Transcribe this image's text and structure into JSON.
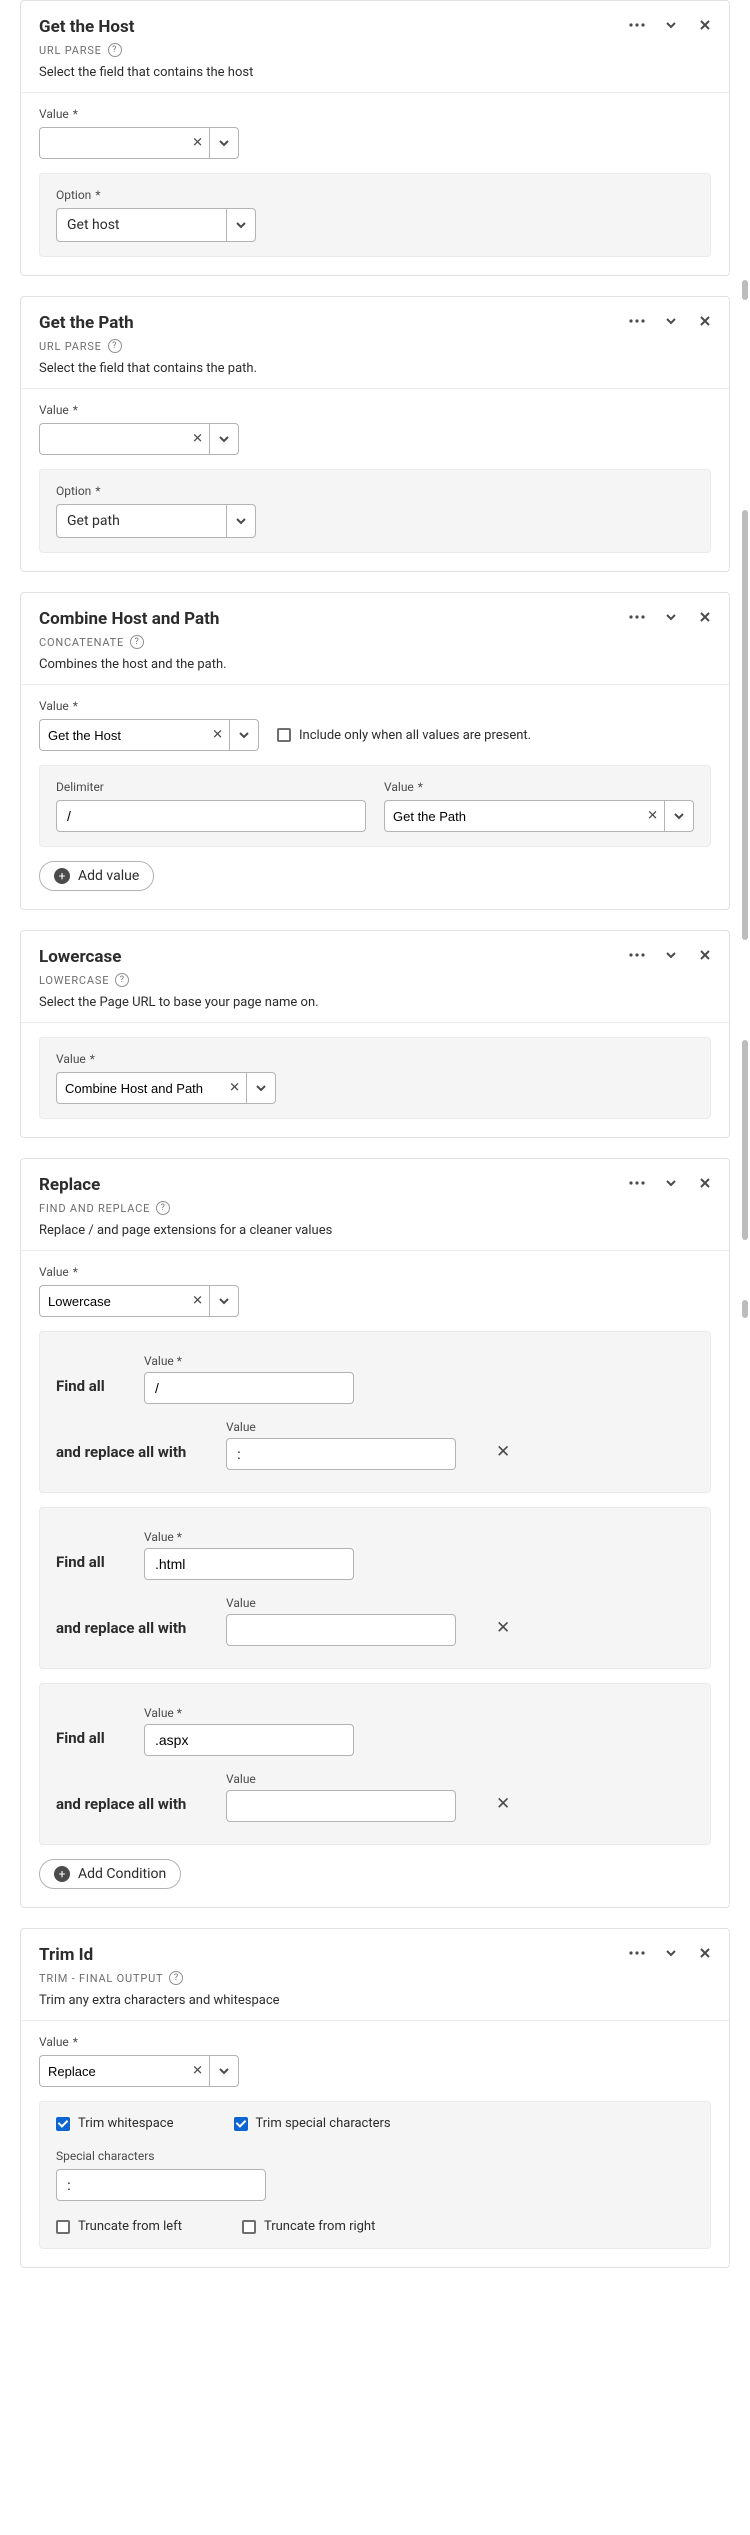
{
  "labels": {
    "value": "Value",
    "option": "Option",
    "delimiter": "Delimiter",
    "special_chars": "Special characters"
  },
  "buttons": {
    "add_value": "Add value",
    "add_condition": "Add Condition"
  },
  "cards": [
    {
      "id": "host",
      "title": "Get the Host",
      "type": "URL PARSE",
      "desc": "Select the field that contains the host",
      "value": "",
      "option": "Get host"
    },
    {
      "id": "path",
      "title": "Get the Path",
      "type": "URL PARSE",
      "desc": "Select the field that contains the path.",
      "value": "",
      "option": "Get path"
    },
    {
      "id": "combine",
      "title": "Combine Host and Path",
      "type": "CONCATENATE",
      "desc": "Combines the host and the path.",
      "value": "Get the Host",
      "include_label": "Include only when all values are present.",
      "delimiter": "/",
      "extra_value": "Get the Path"
    },
    {
      "id": "lowercase",
      "title": "Lowercase",
      "type": "LOWERCASE",
      "desc": "Select the Page URL to base your page name on.",
      "value": "Combine Host and Path"
    },
    {
      "id": "replace",
      "title": "Replace",
      "type": "FIND AND REPLACE",
      "desc": "Replace / and page extensions for a cleaner values",
      "value": "Lowercase",
      "find_label": "Find all",
      "replace_label": "and replace all with",
      "conditions": [
        {
          "find": "/",
          "replace": ":"
        },
        {
          "find": ".html",
          "replace": ""
        },
        {
          "find": ".aspx",
          "replace": ""
        }
      ]
    },
    {
      "id": "trim",
      "title": "Trim Id",
      "type": "TRIM - FINAL OUTPUT",
      "desc": "Trim any extra characters and whitespace",
      "value": "Replace",
      "trim_whitespace_label": "Trim whitespace",
      "trim_special_label": "Trim special characters",
      "special_chars": ":",
      "truncate_left_label": "Truncate from left",
      "truncate_right_label": "Truncate from right"
    }
  ]
}
